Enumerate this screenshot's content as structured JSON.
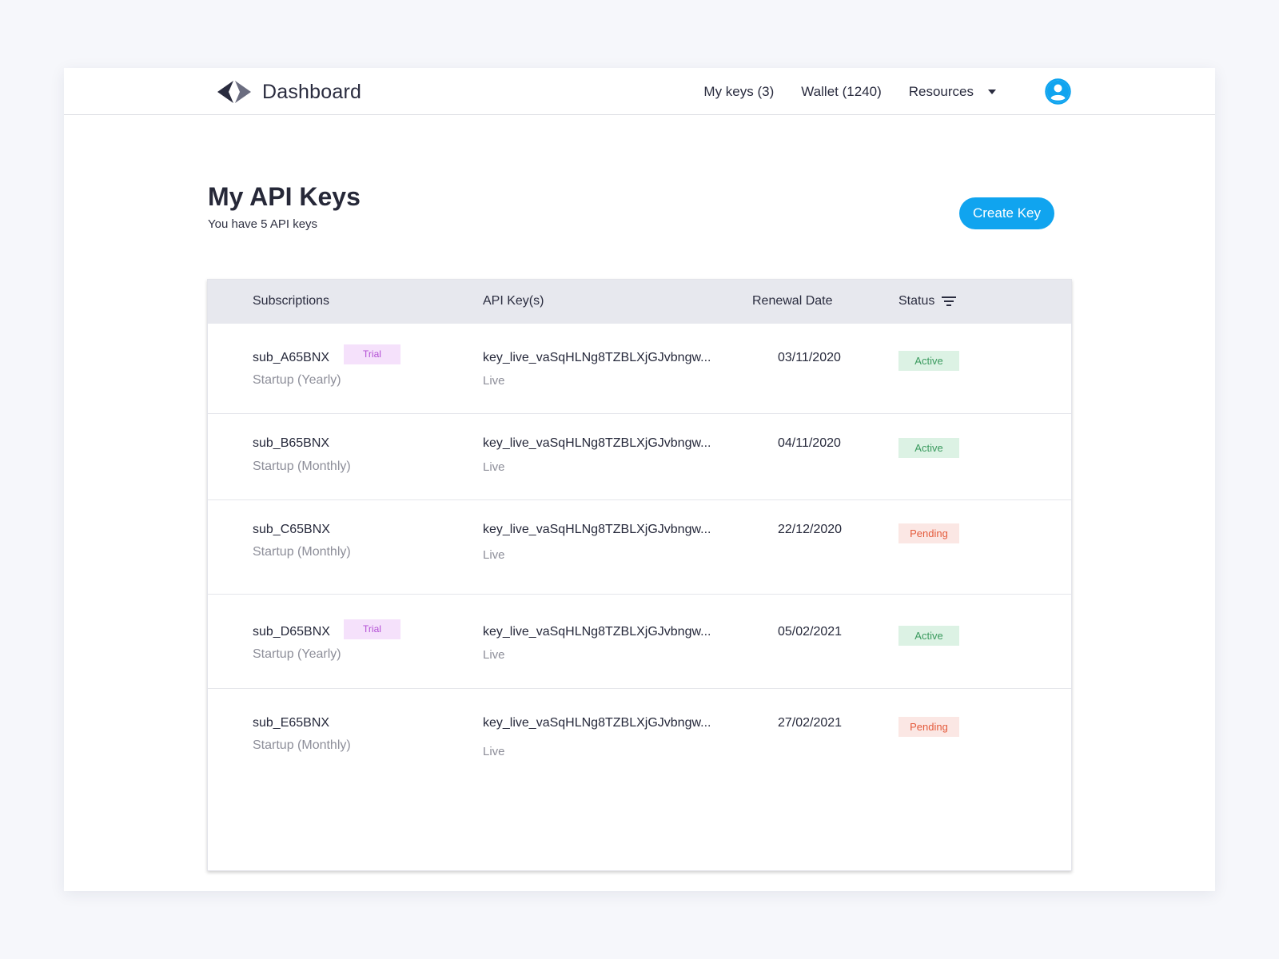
{
  "header": {
    "brand": "Dashboard",
    "nav": {
      "my_keys": "My keys (3)",
      "wallet": "Wallet (1240)",
      "resources": "Resources"
    }
  },
  "page": {
    "title": "My API Keys",
    "subtitle": "You have 5 API keys",
    "create_button": "Create Key"
  },
  "table": {
    "columns": {
      "subscriptions": "Subscriptions",
      "api_keys": "API Key(s)",
      "renewal_date": "Renewal Date",
      "status": "Status"
    },
    "rows": [
      {
        "sub_id": "sub_A65BNX",
        "tag": "Trial",
        "plan": "Startup (Yearly)",
        "key": "key_live_vaSqHLNg8TZBLXjGJvbngw...",
        "env": "Live",
        "date": "03/11/2020",
        "status": "Active"
      },
      {
        "sub_id": "sub_B65BNX",
        "tag": "",
        "plan": "Startup (Monthly)",
        "key": "key_live_vaSqHLNg8TZBLXjGJvbngw...",
        "env": "Live",
        "date": "04/11/2020",
        "status": "Active"
      },
      {
        "sub_id": "sub_C65BNX",
        "tag": "",
        "plan": "Startup (Monthly)",
        "key": "key_live_vaSqHLNg8TZBLXjGJvbngw...",
        "env": "Live",
        "date": "22/12/2020",
        "status": "Pending"
      },
      {
        "sub_id": "sub_D65BNX",
        "tag": "Trial",
        "plan": "Startup (Yearly)",
        "key": "key_live_vaSqHLNg8TZBLXjGJvbngw...",
        "env": "Live",
        "date": "05/02/2021",
        "status": "Active"
      },
      {
        "sub_id": "sub_E65BNX",
        "tag": "",
        "plan": "Startup (Monthly)",
        "key": "key_live_vaSqHLNg8TZBLXjGJvbngw...",
        "env": "Live",
        "date": "27/02/2021",
        "status": "Pending"
      }
    ]
  },
  "colors": {
    "accent": "#10a4ef",
    "active_bg": "#dcf2e4",
    "active_text": "#3a9a5e",
    "pending_bg": "#fbe7e4",
    "pending_text": "#e45b3c",
    "trial_bg": "#f5e1fb",
    "trial_text": "#b34fd5"
  },
  "icons": {
    "logo": "brackets-logo-icon",
    "resources_caret": "caret-down-icon",
    "avatar": "user-avatar-icon",
    "status_filter": "filter-icon"
  }
}
